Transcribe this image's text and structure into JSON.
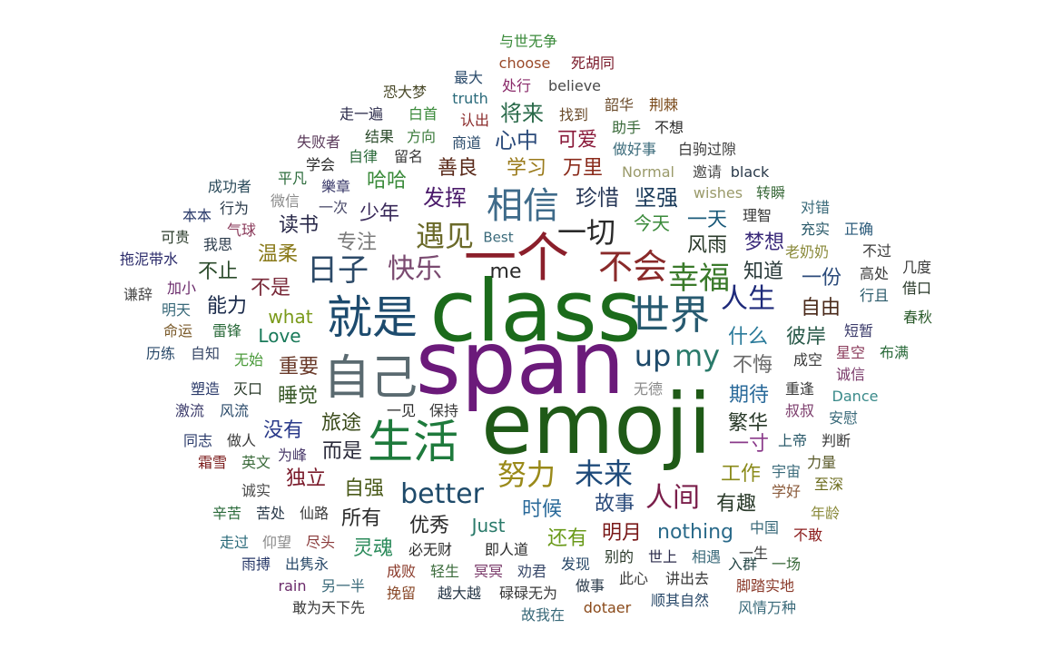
{
  "words": [
    {
      "text": "class",
      "color": "#1b6b1b"
    },
    {
      "text": "span",
      "color": "#6b1a7a"
    },
    {
      "text": "emoji",
      "color": "#1f5a17"
    },
    {
      "text": "一个",
      "color": "#8b1f2b"
    },
    {
      "text": "就是",
      "color": "#1d4b6e"
    },
    {
      "text": "自己",
      "color": "#5a6a70"
    },
    {
      "text": "生活",
      "color": "#1e7a3c"
    },
    {
      "text": "世界",
      "color": "#275a70"
    },
    {
      "text": "相信",
      "color": "#3f6b8a"
    },
    {
      "text": "不会",
      "color": "#8a2a2a"
    },
    {
      "text": "日子",
      "color": "#2c4a68"
    },
    {
      "text": "快乐",
      "color": "#7a4a70"
    },
    {
      "text": "遇见",
      "color": "#6b6a2a"
    },
    {
      "text": "一切",
      "color": "#2a2a2a"
    },
    {
      "text": "幸福",
      "color": "#3a7a2a"
    },
    {
      "text": "人生",
      "color": "#1e2a7a"
    },
    {
      "text": "up",
      "color": "#1e4a6a"
    },
    {
      "text": "my",
      "color": "#2a7a6a"
    },
    {
      "text": "努力",
      "color": "#9a8a1a"
    },
    {
      "text": "未来",
      "color": "#1e4a7a"
    },
    {
      "text": "人间",
      "color": "#7a1e4a"
    },
    {
      "text": "better",
      "color": "#1e4a6a"
    },
    {
      "text": "me",
      "color": "#2a2a2a"
    },
    {
      "text": "珍惜",
      "color": "#2a3a5a"
    },
    {
      "text": "坚强",
      "color": "#1a3a5a"
    },
    {
      "text": "发挥",
      "color": "#4a1a6a"
    },
    {
      "text": "善良",
      "color": "#5a2a1a"
    },
    {
      "text": "学习",
      "color": "#9a7a1a"
    },
    {
      "text": "万里",
      "color": "#8a2a1a"
    },
    {
      "text": "心中",
      "color": "#2a4a7a"
    },
    {
      "text": "可爱",
      "color": "#8a1a3a"
    },
    {
      "text": "将来",
      "color": "#2a6a4a"
    },
    {
      "text": "哈哈",
      "color": "#3a8a3a"
    },
    {
      "text": "少年",
      "color": "#3a2a5a"
    },
    {
      "text": "读书",
      "color": "#2a2a4a"
    },
    {
      "text": "温柔",
      "color": "#8a7a1a"
    },
    {
      "text": "专注",
      "color": "#7a7a7a"
    },
    {
      "text": "不止",
      "color": "#2a4a2a"
    },
    {
      "text": "不是",
      "color": "#7a2a3a"
    },
    {
      "text": "能力",
      "color": "#1a2a4a"
    },
    {
      "text": "what",
      "color": "#7a9a1a"
    },
    {
      "text": "Love",
      "color": "#1a7a5a"
    },
    {
      "text": "重要",
      "color": "#6a3a2a"
    },
    {
      "text": "睡觉",
      "color": "#3a5a2a"
    },
    {
      "text": "旅途",
      "color": "#3a4a1a"
    },
    {
      "text": "没有",
      "color": "#2a3a8a"
    },
    {
      "text": "而是",
      "color": "#2a2a3a"
    },
    {
      "text": "独立",
      "color": "#7a1a2a"
    },
    {
      "text": "自强",
      "color": "#4a5a1a"
    },
    {
      "text": "所有",
      "color": "#2a2a2a"
    },
    {
      "text": "优秀",
      "color": "#2a2a2a"
    },
    {
      "text": "Just",
      "color": "#2a7a6a"
    },
    {
      "text": "灵魂",
      "color": "#2a8a5a"
    },
    {
      "text": "时候",
      "color": "#2a6a9a"
    },
    {
      "text": "还有",
      "color": "#6a9a1a"
    },
    {
      "text": "故事",
      "color": "#2a4a7a"
    },
    {
      "text": "明月",
      "color": "#7a1a1a"
    },
    {
      "text": "nothing",
      "color": "#2a6a8a"
    },
    {
      "text": "有趣",
      "color": "#2a3a2a"
    },
    {
      "text": "工作",
      "color": "#8a8a1a"
    },
    {
      "text": "今天",
      "color": "#3a8a3a"
    },
    {
      "text": "一天",
      "color": "#1a5a7a"
    },
    {
      "text": "风雨",
      "color": "#2a3a2a"
    },
    {
      "text": "梦想",
      "color": "#3a2a7a"
    },
    {
      "text": "知道",
      "color": "#2a3a3a"
    },
    {
      "text": "一份",
      "color": "#2a4a7a"
    },
    {
      "text": "自由",
      "color": "#4a2a1a"
    },
    {
      "text": "什么",
      "color": "#2a7a9a"
    },
    {
      "text": "彼岸",
      "color": "#2a5a4a"
    },
    {
      "text": "不悔",
      "color": "#6a6a6a"
    },
    {
      "text": "期待",
      "color": "#2a6a9a"
    },
    {
      "text": "繁华",
      "color": "#2a3a2a"
    },
    {
      "text": "一寸",
      "color": "#8a3a8a"
    },
    {
      "text": "与世无争",
      "color": "#3a8a3a"
    },
    {
      "text": "choose",
      "color": "#9a4a2a"
    },
    {
      "text": "死胡同",
      "color": "#7a1a2a"
    },
    {
      "text": "最大",
      "color": "#2a4a6a"
    },
    {
      "text": "truth",
      "color": "#2a6a7a"
    },
    {
      "text": "处行",
      "color": "#8a2a6a"
    },
    {
      "text": "believe",
      "color": "#4a4a4a"
    },
    {
      "text": "恐大梦",
      "color": "#4a4a2a"
    },
    {
      "text": "走一遍",
      "color": "#2a2a4a"
    },
    {
      "text": "白首",
      "color": "#3a8a3a"
    },
    {
      "text": "认出",
      "color": "#8a2a2a"
    },
    {
      "text": "找到",
      "color": "#6a4a2a"
    },
    {
      "text": "韶华",
      "color": "#6a4a2a"
    },
    {
      "text": "荆棘",
      "color": "#7a4a1a"
    },
    {
      "text": "助手",
      "color": "#3a6a3a"
    },
    {
      "text": "不想",
      "color": "#2a2a2a"
    },
    {
      "text": "失败者",
      "color": "#5a3a5a"
    },
    {
      "text": "结果",
      "color": "#2a4a2a"
    },
    {
      "text": "方向",
      "color": "#3a7a3a"
    },
    {
      "text": "商道",
      "color": "#2a4a6a"
    },
    {
      "text": "做好事",
      "color": "#3a6a7a"
    },
    {
      "text": "白驹过隙",
      "color": "#3a3a3a"
    },
    {
      "text": "学会",
      "color": "#2a2a2a"
    },
    {
      "text": "自律",
      "color": "#2a6a3a"
    },
    {
      "text": "留名",
      "color": "#3a3a3a"
    },
    {
      "text": "平凡",
      "color": "#2a6a3a"
    },
    {
      "text": "Normal",
      "color": "#9a9a6a"
    },
    {
      "text": "邀请",
      "color": "#4a4a4a"
    },
    {
      "text": "black",
      "color": "#2a3a4a"
    },
    {
      "text": "成功者",
      "color": "#2a4a5a"
    },
    {
      "text": "樂章",
      "color": "#3a3a6a"
    },
    {
      "text": "wishes",
      "color": "#9a9a6a"
    },
    {
      "text": "转瞬",
      "color": "#3a6a3a"
    },
    {
      "text": "对错",
      "color": "#3a6a7a"
    },
    {
      "text": "本本",
      "color": "#2a3a6a"
    },
    {
      "text": "行为",
      "color": "#2a3a4a"
    },
    {
      "text": "微信",
      "color": "#8a8a8a"
    },
    {
      "text": "一次",
      "color": "#4a4a6a"
    },
    {
      "text": "理智",
      "color": "#3a3a3a"
    },
    {
      "text": "充实",
      "color": "#2a5a6a"
    },
    {
      "text": "正确",
      "color": "#2a5a7a"
    },
    {
      "text": "气球",
      "color": "#8a3a5a"
    },
    {
      "text": "可贵",
      "color": "#2a3a2a"
    },
    {
      "text": "我思",
      "color": "#2a3a4a"
    },
    {
      "text": "Best",
      "color": "#3a6a7a"
    },
    {
      "text": "老奶奶",
      "color": "#8a8a3a"
    },
    {
      "text": "不过",
      "color": "#3a3a3a"
    },
    {
      "text": "拖泥带水",
      "color": "#2a2a6a"
    },
    {
      "text": "几度",
      "color": "#3a3a3a"
    },
    {
      "text": "高处",
      "color": "#3a3a3a"
    },
    {
      "text": "加小",
      "color": "#6a2a6a"
    },
    {
      "text": "谦辞",
      "color": "#4a4a4a"
    },
    {
      "text": "借口",
      "color": "#2a3a2a"
    },
    {
      "text": "行且",
      "color": "#2a5a6a"
    },
    {
      "text": "明天",
      "color": "#3a6a7a"
    },
    {
      "text": "命运",
      "color": "#7a5a2a"
    },
    {
      "text": "雷锋",
      "color": "#2a6a3a"
    },
    {
      "text": "短暂",
      "color": "#3a3a6a"
    },
    {
      "text": "春秋",
      "color": "#2a5a2a"
    },
    {
      "text": "历练",
      "color": "#2a4a6a"
    },
    {
      "text": "自知",
      "color": "#3a4a6a"
    },
    {
      "text": "星空",
      "color": "#8a3a5a"
    },
    {
      "text": "布满",
      "color": "#2a6a3a"
    },
    {
      "text": "无始",
      "color": "#4a9a3a"
    },
    {
      "text": "成空",
      "color": "#3a3a3a"
    },
    {
      "text": "诚信",
      "color": "#7a3a6a"
    },
    {
      "text": "塑造",
      "color": "#2a3a6a"
    },
    {
      "text": "灭口",
      "color": "#2a3a2a"
    },
    {
      "text": "无德",
      "color": "#8a8a8a"
    },
    {
      "text": "重逢",
      "color": "#3a3a3a"
    },
    {
      "text": "Dance",
      "color": "#3a8a8a"
    },
    {
      "text": "激流",
      "color": "#3a3a6a"
    },
    {
      "text": "风流",
      "color": "#2a4a6a"
    },
    {
      "text": "一见",
      "color": "#2a2a2a"
    },
    {
      "text": "保持",
      "color": "#3a3a3a"
    },
    {
      "text": "叔叔",
      "color": "#7a3a6a"
    },
    {
      "text": "安慰",
      "color": "#3a6a7a"
    },
    {
      "text": "同志",
      "color": "#2a3a6a"
    },
    {
      "text": "做人",
      "color": "#3a3a3a"
    },
    {
      "text": "为峰",
      "color": "#4a3a6a"
    },
    {
      "text": "上帝",
      "color": "#2a5a6a"
    },
    {
      "text": "判断",
      "color": "#3a3a3a"
    },
    {
      "text": "霜雪",
      "color": "#7a1a1a"
    },
    {
      "text": "英文",
      "color": "#3a6a3a"
    },
    {
      "text": "力量",
      "color": "#5a5a2a"
    },
    {
      "text": "宇宙",
      "color": "#3a6a7a"
    },
    {
      "text": "至深",
      "color": "#6a6a1a"
    },
    {
      "text": "诚实",
      "color": "#4a4a4a"
    },
    {
      "text": "学好",
      "color": "#8a5a3a"
    },
    {
      "text": "年龄",
      "color": "#8a8a3a"
    },
    {
      "text": "辛苦",
      "color": "#2a6a3a"
    },
    {
      "text": "苦处",
      "color": "#2a3a4a"
    },
    {
      "text": "仙路",
      "color": "#3a3a3a"
    },
    {
      "text": "中国",
      "color": "#3a6a7a"
    },
    {
      "text": "不敢",
      "color": "#8a1a1a"
    },
    {
      "text": "走过",
      "color": "#2a6a7a"
    },
    {
      "text": "仰望",
      "color": "#8a8a8a"
    },
    {
      "text": "尽头",
      "color": "#8a3a3a"
    },
    {
      "text": "必无财",
      "color": "#2a2a2a"
    },
    {
      "text": "即人道",
      "color": "#2a2a2a"
    },
    {
      "text": "别的",
      "color": "#2a3a2a"
    },
    {
      "text": "世上",
      "color": "#2a2a4a"
    },
    {
      "text": "相遇",
      "color": "#3a6a7a"
    },
    {
      "text": "一生",
      "color": "#3a3a3a"
    },
    {
      "text": "入群",
      "color": "#2a4a4a"
    },
    {
      "text": "一场",
      "color": "#3a6a3a"
    },
    {
      "text": "雨搏",
      "color": "#2a3a6a"
    },
    {
      "text": "出隽永",
      "color": "#2a4a6a"
    },
    {
      "text": "成败",
      "color": "#8a3a2a"
    },
    {
      "text": "轻生",
      "color": "#3a6a3a"
    },
    {
      "text": "冥冥",
      "color": "#7a3a6a"
    },
    {
      "text": "劝君",
      "color": "#3a4a6a"
    },
    {
      "text": "发现",
      "color": "#2a4a6a"
    },
    {
      "text": "做事",
      "color": "#2a3a4a"
    },
    {
      "text": "此心",
      "color": "#3a3a3a"
    },
    {
      "text": "讲出去",
      "color": "#3a3a3a"
    },
    {
      "text": "脚踏实地",
      "color": "#8a3a2a"
    },
    {
      "text": "rain",
      "color": "#6a2a6a"
    },
    {
      "text": "另一半",
      "color": "#3a6a7a"
    },
    {
      "text": "挽留",
      "color": "#8a4a2a"
    },
    {
      "text": "越大越",
      "color": "#2a3a4a"
    },
    {
      "text": "碌碌无为",
      "color": "#3a3a3a"
    },
    {
      "text": "顺其自然",
      "color": "#2a4a6a"
    },
    {
      "text": "风情万种",
      "color": "#3a6a7a"
    },
    {
      "text": "敢为天下先",
      "color": "#3a3a3a"
    },
    {
      "text": "dotaer",
      "color": "#8a4a1a"
    },
    {
      "text": "故我在",
      "color": "#3a6a7a"
    }
  ]
}
